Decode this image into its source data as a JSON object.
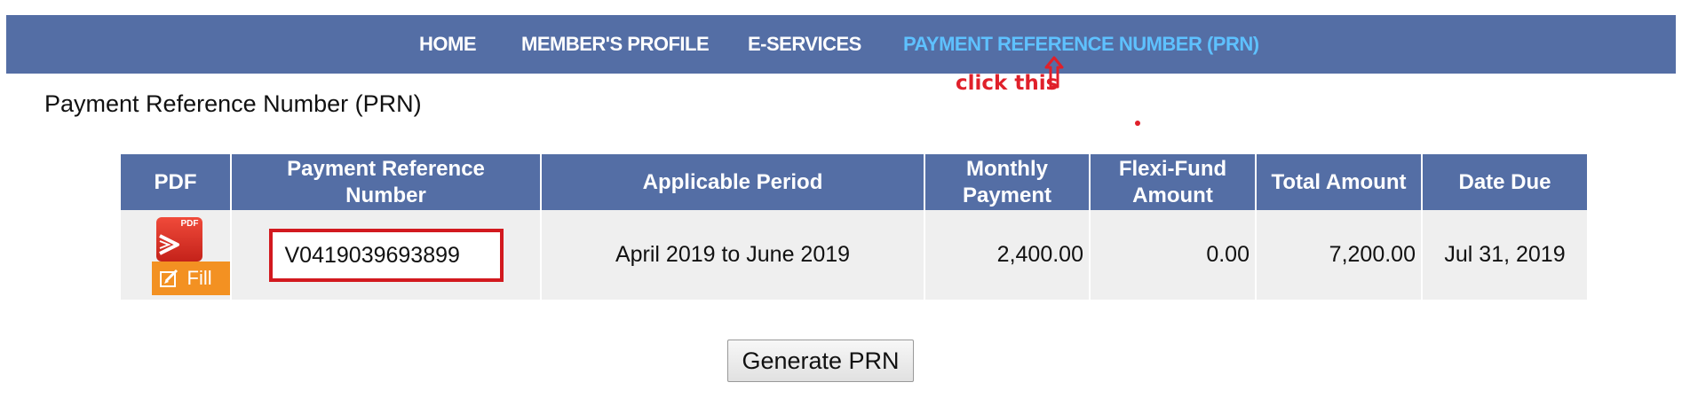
{
  "nav": {
    "items": [
      {
        "label": "HOME",
        "active": false
      },
      {
        "label": "MEMBER'S PROFILE",
        "active": false
      },
      {
        "label": "E-SERVICES",
        "active": false
      },
      {
        "label": "PAYMENT REFERENCE NUMBER (PRN)",
        "active": true
      }
    ],
    "bg_color": "#546ea5",
    "active_color": "#5ec1ff"
  },
  "annotation": {
    "text": "click this",
    "color": "#e0202a"
  },
  "page_title": "Payment Reference Number (PRN)",
  "table": {
    "headers": {
      "pdf": "PDF",
      "ref_line1": "Payment Reference",
      "ref_line2": "Number",
      "period": "Applicable Period",
      "monthly_line1": "Monthly",
      "monthly_line2": "Payment",
      "flexi_line1": "Flexi-Fund",
      "flexi_line2": "Amount",
      "total": "Total Amount",
      "due": "Date Due"
    },
    "rows": [
      {
        "pdf_icon_label": "PDF",
        "fill_label": "Fill",
        "ref_number": "V0419039693899",
        "period": "April 2019 to June 2019",
        "monthly": "2,400.00",
        "flexi": "0.00",
        "total": "7,200.00",
        "due": "Jul 31, 2019"
      }
    ]
  },
  "generate_button": "Generate PRN"
}
